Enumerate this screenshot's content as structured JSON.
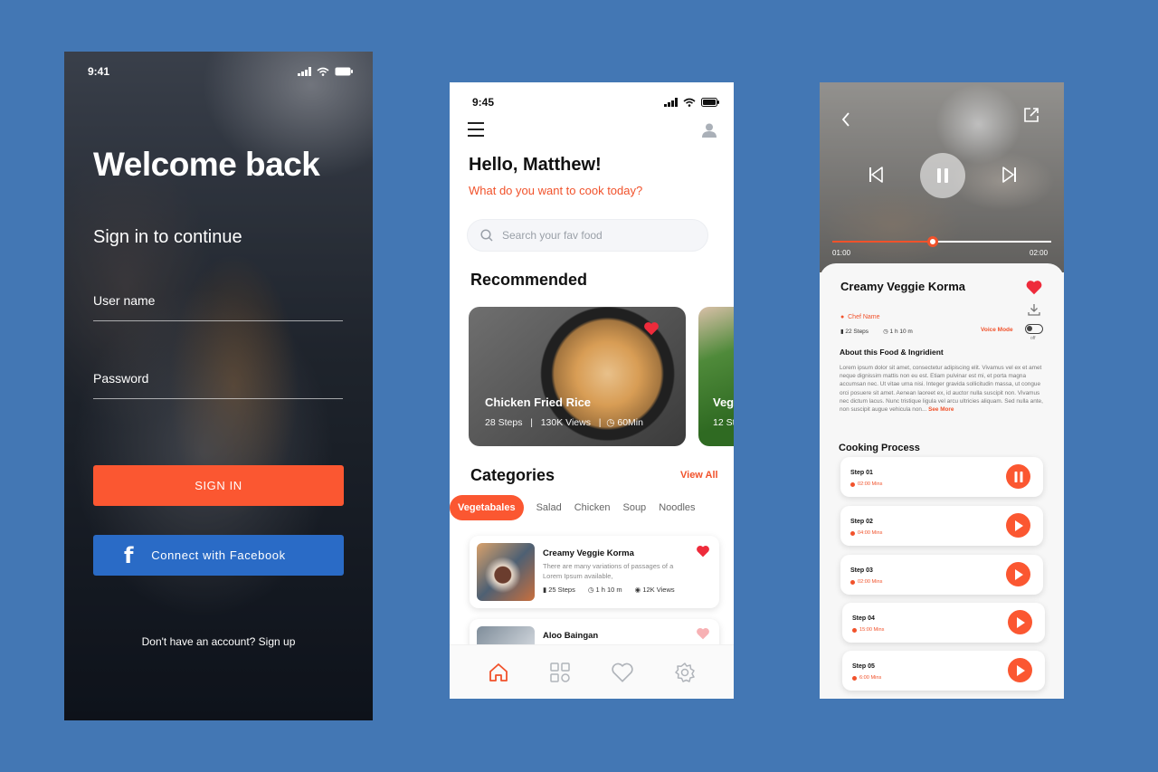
{
  "login": {
    "time": "9:41",
    "title": "Welcome back",
    "subtitle": "Sign in to continue",
    "username_label": "User name",
    "password_label": "Password",
    "signin_label": "SIGN IN",
    "facebook_label": "Connect with Facebook",
    "signup_text": "Don't have an account? Sign up"
  },
  "home": {
    "time": "9:45",
    "greeting": "Hello, Matthew!",
    "prompt": "What do you want to cook today?",
    "search_placeholder": "Search your fav food",
    "recommended_title": "Recommended",
    "recommended": [
      {
        "title": "Chicken Fried Rice",
        "steps": "28 Steps",
        "views": "130K Views",
        "time": "60Min"
      },
      {
        "title": "Veg",
        "steps": "12 St"
      }
    ],
    "categories_title": "Categories",
    "view_all": "View All",
    "categories": [
      "Vegetabales",
      "Salad",
      "Chicken",
      "Soup",
      "Noodles"
    ],
    "list": [
      {
        "title": "Creamy Veggie Korma",
        "desc": "There are many variations of passages of a Lorem Ipsum available,",
        "steps": "25 Steps",
        "time": "1 h 10 m",
        "views": "12K Views"
      },
      {
        "title": "Aloo Baingan"
      }
    ]
  },
  "detail": {
    "time_current": "01:00",
    "time_total": "02:00",
    "progress": 0.46,
    "title": "Creamy Veggie Korma",
    "chef": "Chef Name",
    "steps": "22 Steps",
    "duration": "1 h 10 m",
    "voice_mode": "Voice Mode",
    "toggle_state": "off",
    "about_title": "About this Food & Ingridient",
    "about_text": "Lorem ipsum dolor sit amet, consectetur adipiscing elit. Vivamus vel ex et amet neque dignissim mattis non eu est. Etiam pulvinar est mi, et porta magna accumsan nec. Ut vitae urna nisi. Integer gravida sollicitudin massa, ut congue orci posuere sit amet. Aenean laoreet ex, id auctor nulla suscipit non. Vivamus nec dictum lacus. Nunc tristique ligula vel arcu ultricies aliquam. Sed nulla ante, non suscipit augue vehicula non...",
    "see_more": "See More",
    "process_title": "Cooking Process",
    "steps_list": [
      {
        "name": "Step 01",
        "duration": "02:00 Mins",
        "state": "pause"
      },
      {
        "name": "Step 02",
        "duration": "04:00 Mins",
        "state": "play"
      },
      {
        "name": "Step 03",
        "duration": "02:00 Mins",
        "state": "play"
      },
      {
        "name": "Step 04",
        "duration": "15:00 Mins",
        "state": "play"
      },
      {
        "name": "Step 05",
        "duration": "6:00 Mins",
        "state": "play"
      }
    ]
  },
  "colors": {
    "accent": "#fb5731",
    "facebook": "#2a6bc6",
    "background": "#4377b4"
  }
}
